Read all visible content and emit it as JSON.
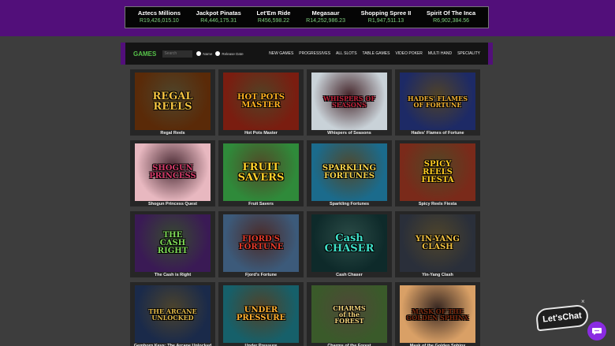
{
  "jackpots": [
    {
      "name": "Aztecs Millions",
      "amount": "R19,426,015.10"
    },
    {
      "name": "Jackpot Pinatas",
      "amount": "R4,446,175.31"
    },
    {
      "name": "Let'Em Ride",
      "amount": "R456,598.22"
    },
    {
      "name": "Megasaur",
      "amount": "R14,252,986.23"
    },
    {
      "name": "Shopping Spree II",
      "amount": "R1,947,511.13"
    },
    {
      "name": "Spirit Of The Inca",
      "amount": "R6,902,384.56"
    }
  ],
  "games_bar": {
    "title": "GAMES",
    "search_placeholder": "Search",
    "radio_name": "Name",
    "radio_release": "Release Date",
    "nav": [
      "NEW GAMES",
      "PROGRESSIVES",
      "ALL SLOTS",
      "TABLE GAMES",
      "VIDEO POKER",
      "MULTI HAND",
      "SPECIALITY"
    ]
  },
  "games": [
    {
      "label": "Regal Reels",
      "art": "REGAL\nREELS",
      "bg": "#5a2a08",
      "accent": "#f0c040"
    },
    {
      "label": "Hot Pots Master",
      "art": "HOT POTS\nMASTER",
      "bg": "#7a1d10",
      "accent": "#ffb020"
    },
    {
      "label": "Whispers of Seasons",
      "art": "WHISPERS OF\nSEASONS",
      "bg": "#c9d2d8",
      "accent": "#c0233b"
    },
    {
      "label": "Hades' Flames of Fortune",
      "art": "HADES' FLAMES\nOF FORTUNE",
      "bg": "#1d2a66",
      "accent": "#f2b233"
    },
    {
      "label": "Shogun Princess Quest",
      "art": "SHOGUN\nPRINCESS",
      "bg": "#e8b8c0",
      "accent": "#d23a68"
    },
    {
      "label": "Fruit Savers",
      "art": "FRUIT\nSAVERS",
      "bg": "#2f8a3a",
      "accent": "#ffd02a"
    },
    {
      "label": "Sparkling Fortunes",
      "art": "SPARKLING\nFORTUNES",
      "bg": "#1b6b8c",
      "accent": "#f5d24a"
    },
    {
      "label": "Spicy Reels Fiesta",
      "art": "SPICY\nREELS\nFIESTA",
      "bg": "#7a2a1a",
      "accent": "#ffcc22"
    },
    {
      "label": "The Cash is Right",
      "art": "THE\nCASH\nRIGHT",
      "bg": "#3a1a55",
      "accent": "#7ed957"
    },
    {
      "label": "Fjord's Fortune",
      "art": "FJORD'S\nFORTUNE",
      "bg": "#3c5a7a",
      "accent": "#e23a2a"
    },
    {
      "label": "Cash Chaser",
      "art": "Cash\nCHASER",
      "bg": "#0e2a2a",
      "accent": "#3fe0c8"
    },
    {
      "label": "Yin-Yang Clash",
      "art": "YIN-YANG CLASH",
      "bg": "#2a2f3a",
      "accent": "#f0c040"
    },
    {
      "label": "Gemhorn Keys: The Arcane Unlocked",
      "art": "THE ARCANE\nUNLOCKED",
      "bg": "#1a2a4a",
      "accent": "#e0b84a"
    },
    {
      "label": "Under Pressure",
      "art": "UNDER\nPRESSURE",
      "bg": "#16606a",
      "accent": "#ffb030"
    },
    {
      "label": "Charms of the Forest",
      "art": "CHARMS\nof the\nFOREST",
      "bg": "#3a5a2a",
      "accent": "#f2d27a"
    },
    {
      "label": "Mask of the Golden Sphinx",
      "art": "MASK OF THE\nGOLDEN SPHINX",
      "bg": "#d9a066",
      "accent": "#7a2a10"
    }
  ],
  "chat": {
    "label": "Let'sChat",
    "close": "×"
  }
}
